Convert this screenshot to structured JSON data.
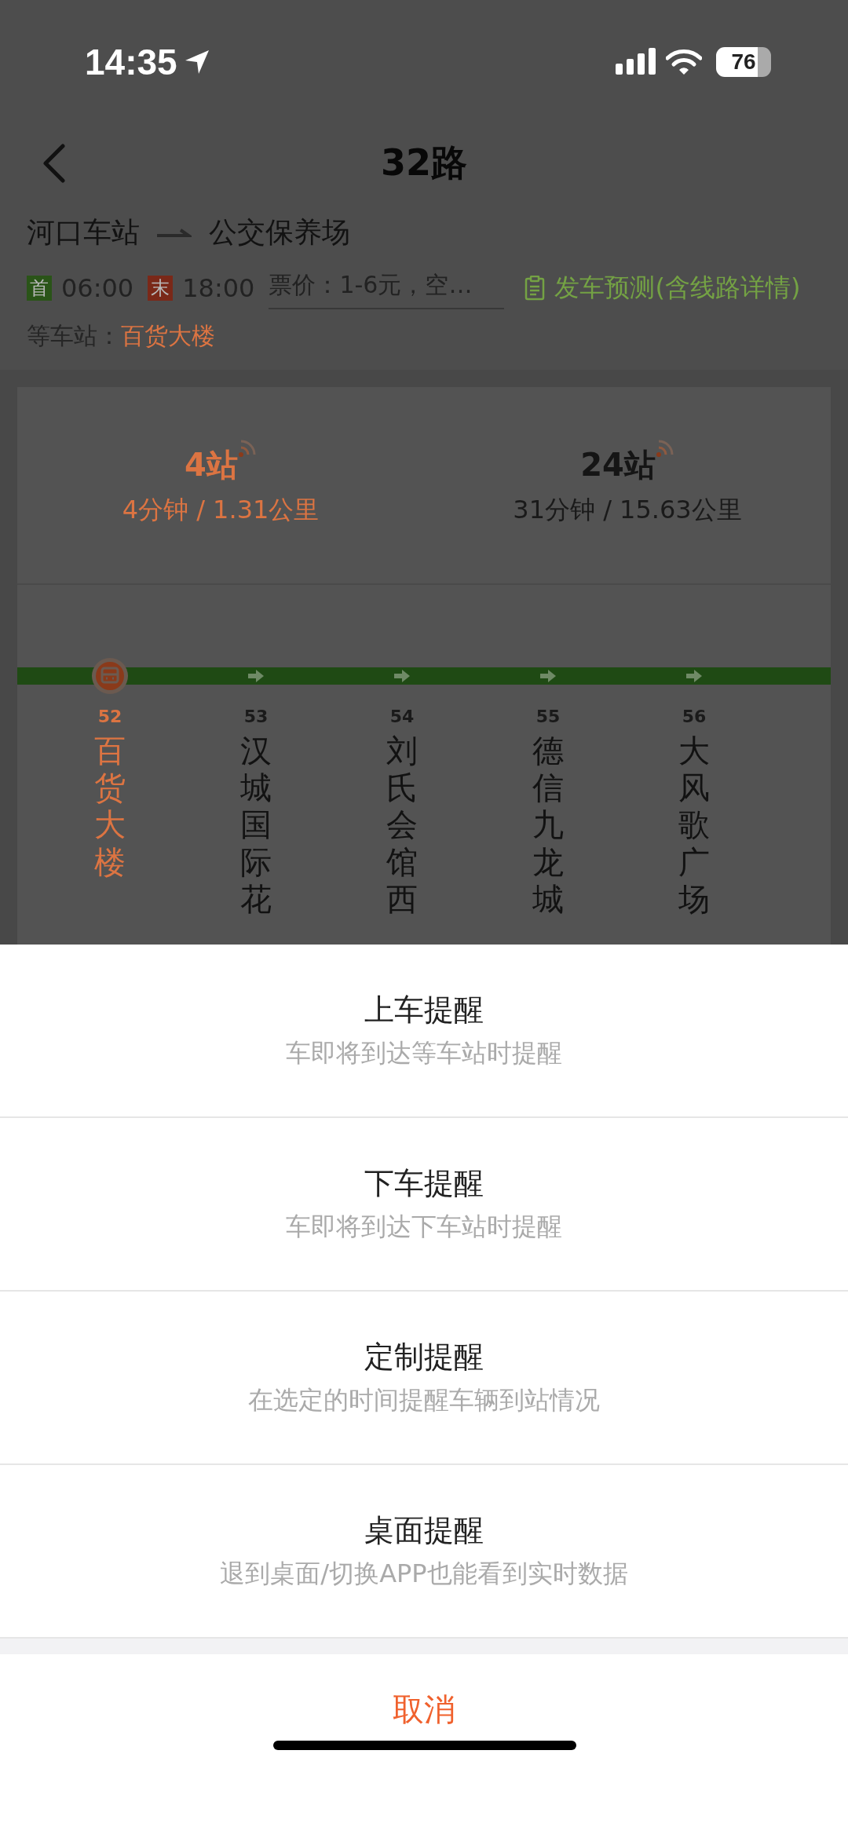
{
  "status_bar": {
    "time": "14:35",
    "battery": "76"
  },
  "header": {
    "title": "32路"
  },
  "route": {
    "from": "河口车站",
    "to": "公交保养场",
    "first_label": "首",
    "first_time": "06:00",
    "last_label": "末",
    "last_time": "18:00",
    "fare": "票价：1-6元，空…",
    "forecast_link": "发车预测(含线路详情)",
    "waiting_label": "等车站：",
    "waiting_station": "百货大楼"
  },
  "buses": [
    {
      "stops": "4站",
      "detail": "4分钟 / 1.31公里",
      "near": true
    },
    {
      "stops": "24站",
      "detail": "31分钟 / 15.63公里",
      "near": false
    }
  ],
  "stations": [
    {
      "number": "52",
      "name": "百货大楼",
      "selected": true
    },
    {
      "number": "53",
      "name": "汉城国际花",
      "selected": false
    },
    {
      "number": "54",
      "name": "刘氏会馆西",
      "selected": false
    },
    {
      "number": "55",
      "name": "德信九龙城",
      "selected": false
    },
    {
      "number": "56",
      "name": "大风歌广场",
      "selected": false
    }
  ],
  "action_sheet": {
    "options": [
      {
        "title": "上车提醒",
        "subtitle": "车即将到达等车站时提醒"
      },
      {
        "title": "下车提醒",
        "subtitle": "车即将到达下车站时提醒"
      },
      {
        "title": "定制提醒",
        "subtitle": "在选定的时间提醒车辆到站情况"
      },
      {
        "title": "桌面提醒",
        "subtitle": "退到桌面/切换APP也能看到实时数据"
      }
    ],
    "cancel": "取消"
  }
}
